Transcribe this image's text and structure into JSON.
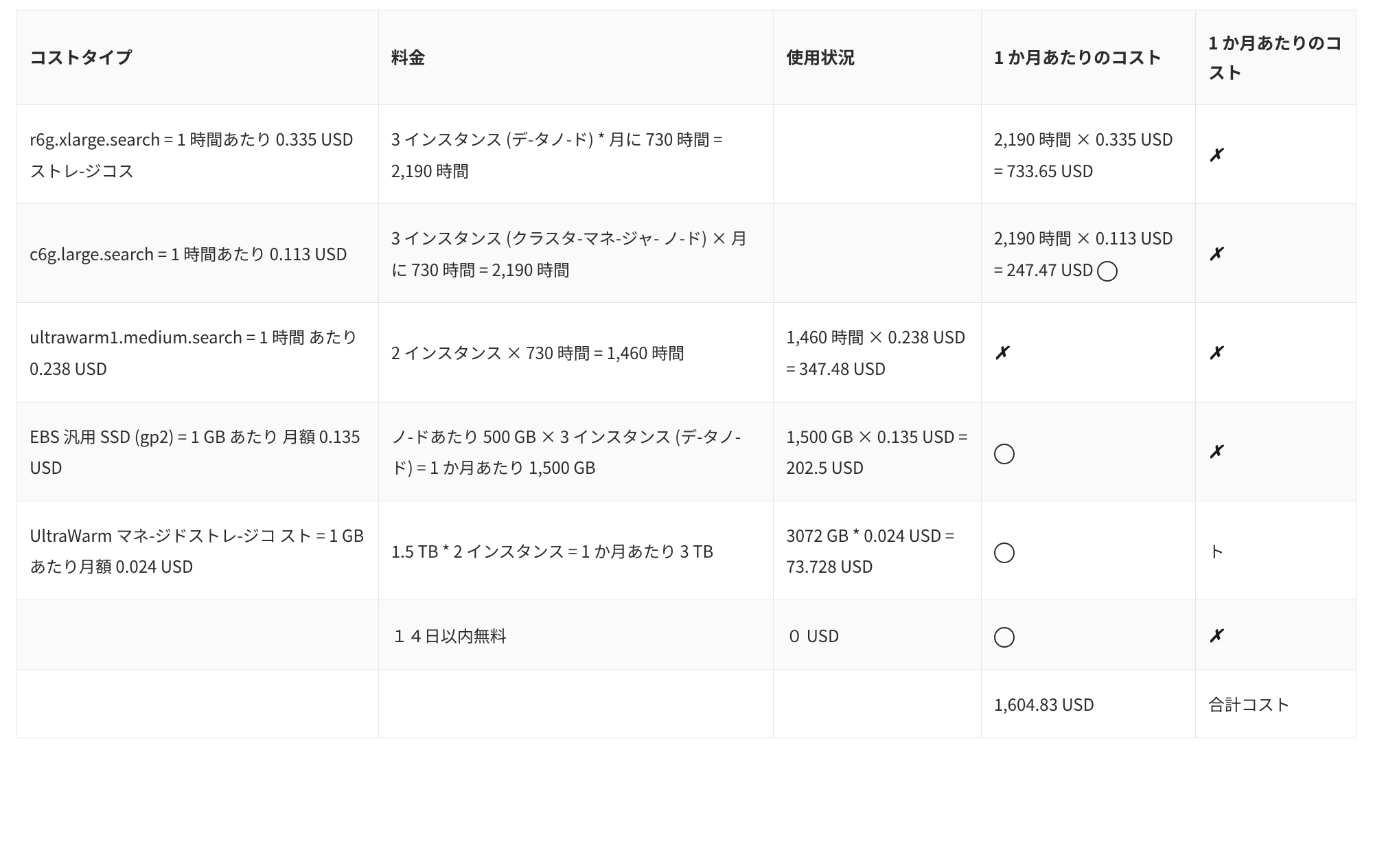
{
  "table": {
    "headers": {
      "cost_type": "コストタイプ",
      "rate": "料金",
      "usage": "使用状況",
      "monthly_cost": "1 か月あたりのコスト",
      "monthly_cost_2": "1 か月あたりのコスト"
    },
    "rows": [
      {
        "cost_type": "r6g.xlarge.search = 1 時間あたり  0.335 USD ストレ-ジコス",
        "rate": "3 インスタンス (デ-タノ-ド) * 月に 730 時間 = 2,190 時間",
        "usage": "",
        "monthly_cost": "2,190 時間 × 0.335 USD = 733.65 USD",
        "monthly_cost_2": "✗"
      },
      {
        "cost_type": "c6g.large.search = 1 時間あたり 0.113 USD",
        "rate": "3 インスタンス (クラスタ-マネ-ジャ- ノ-ド) × 月に 730 時間 = 2,190 時間",
        "usage": "",
        "monthly_cost": "2,190 時間 × 0.113 USD = 247.47 USD ◯",
        "monthly_cost_2": "✗"
      },
      {
        "cost_type": "ultrawarm1.medium.search = 1 時間 あたり 0.238 USD",
        "rate": "2 インスタンス × 730 時間 = 1,460 時間",
        "usage": "1,460 時間 × 0.238  USD = 347.48 USD",
        "monthly_cost": "✗",
        "monthly_cost_2": "✗"
      },
      {
        "cost_type": "EBS 汎用 SSD (gp2) = 1 GB あたり 月額 0.135 USD",
        "rate": "ノ-ドあたり 500 GB × 3 インスタンス  (デ-タノ-ド) = 1 か月あたり 1,500 GB",
        "usage": "1,500 GB × 0.135 USD = 202.5 USD",
        "monthly_cost": "◯",
        "monthly_cost_2": "✗"
      },
      {
        "cost_type": "UltraWarm マネ-ジドストレ-ジコ スト = 1 GB あたり月額 0.024 USD",
        "rate": "1.5 TB * 2 インスタンス = 1 か月あたり  3 TB",
        "usage": "3072 GB * 0.024 USD  = 73.728 USD",
        "monthly_cost": "◯",
        "monthly_cost_2": "ト"
      },
      {
        "cost_type": "",
        "rate": "１４日以内無料",
        "usage": "０ USD",
        "monthly_cost": "◯",
        "monthly_cost_2": "✗"
      },
      {
        "cost_type": "",
        "rate": "",
        "usage": "",
        "monthly_cost": "1,604.83 USD",
        "monthly_cost_2": "合計コスト"
      }
    ]
  }
}
